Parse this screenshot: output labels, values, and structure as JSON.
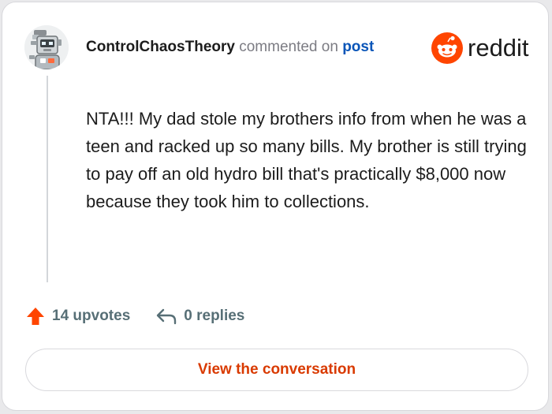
{
  "comment": {
    "username": "ControlChaosTheory",
    "action_text": "commented on",
    "post_link": "post",
    "body": "NTA!!! My dad stole my brothers info from when he was a teen and racked up so many bills. My brother is still trying to pay off an old hydro bill that's practically $8,000 now because they took him to collections."
  },
  "brand": {
    "wordmark": "reddit",
    "logo_icon": "reddit-snoo-icon",
    "color": "#ff4500"
  },
  "stats": {
    "upvotes_label": "14 upvotes",
    "upvote_icon": "upvote-arrow-icon",
    "upvote_color": "#ff4500",
    "replies_label": "0 replies",
    "reply_icon": "reply-arrow-icon"
  },
  "cta": {
    "label": "View the conversation",
    "color": "#d93a00"
  }
}
